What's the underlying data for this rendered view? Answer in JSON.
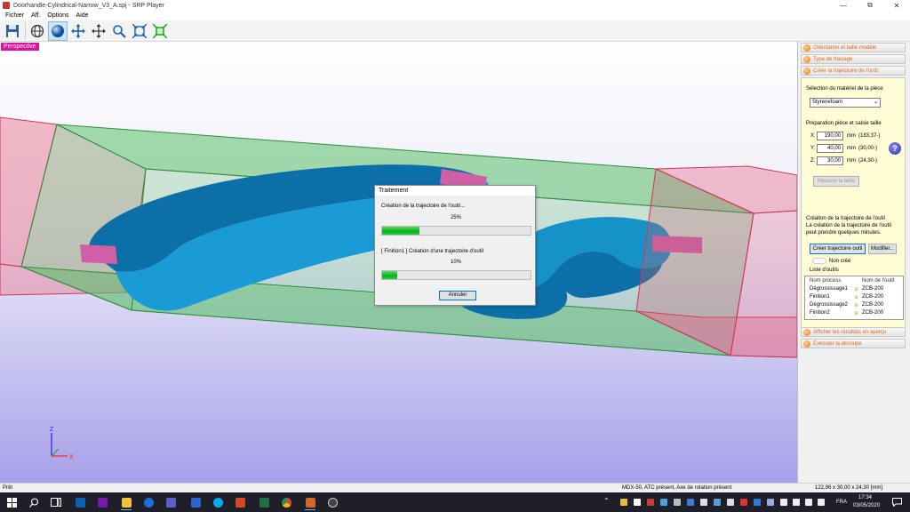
{
  "window": {
    "title": "Doorhandle-Cylindrical-Narrow_V3_A.spj - SRP Player",
    "minimize": "—",
    "restore": "⧉",
    "close": "✕"
  },
  "menu": {
    "items": [
      {
        "label": "Fichier"
      },
      {
        "label": "Aff."
      },
      {
        "label": "Options"
      },
      {
        "label": "Aide"
      }
    ]
  },
  "toolbar": {
    "tools": [
      {
        "icon": "save-icon"
      },
      {
        "icon": "globe-icon"
      },
      {
        "icon": "sphere-icon"
      },
      {
        "icon": "move-icon"
      },
      {
        "icon": "pan-icon"
      },
      {
        "icon": "zoom-icon"
      },
      {
        "icon": "fit-icon"
      },
      {
        "icon": "fit-all-icon"
      }
    ]
  },
  "viewport": {
    "label": "Perspective",
    "axes": {
      "z": "Z",
      "x": "X"
    }
  },
  "dialog": {
    "title": "Traitement",
    "task1_text": "Création de la trajectoire de l'outil...",
    "task1_percent_label": "25%",
    "task1_progress": 25,
    "task2_text": "[ Finition1 ] Création d'une trajectoire d'outil",
    "task2_percent_label": "10%",
    "task2_progress": 10,
    "cancel_label": "Annuler"
  },
  "panel": {
    "sections": [
      {
        "label": "Orientation et taille modèle"
      },
      {
        "label": "Type de fraisage"
      },
      {
        "label": "Créer la trajectoire de l'outil"
      }
    ],
    "material_heading": "Sélection du matériel de la pièce",
    "material_value": "Styrenefoam",
    "size_heading": "Préparation pièce et saisie taille",
    "dims": [
      {
        "axis": "X:",
        "value": "190,00",
        "unit": "mm",
        "range": "(183,37-)"
      },
      {
        "axis": "Y:",
        "value": "40,00",
        "unit": "mm",
        "range": "(30,00-)"
      },
      {
        "axis": "Z:",
        "value": "30,00",
        "unit": "mm",
        "range": "(24,30-)"
      }
    ],
    "help_label": "?",
    "measure_btn": "Mesurer la taille",
    "path_heading": "Création de la trajectoire de l'outil",
    "path_note_1": "La création de la trajectoire de l'outil",
    "path_note_2": "peut prendre quelques minutes.",
    "create_btn": "Créer trajectoire outil",
    "modify_btn": "Modifier...",
    "status_label": "Non créé",
    "tools_list_label": "Liste d'outils",
    "table": {
      "headers": [
        "Nom process",
        "Nom de l'outil"
      ],
      "rows": [
        {
          "process": "Dégrossissage1",
          "tool": "ZCB-200"
        },
        {
          "process": "Finition1",
          "tool": "ZCB-200"
        },
        {
          "process": "Dégrossissage2",
          "tool": "ZCB-200"
        },
        {
          "process": "Finition2",
          "tool": "ZCB-200"
        }
      ]
    },
    "preview_btn": "Afficher les résultats en aperçu",
    "cut_btn": "Exécuter la découpe"
  },
  "statusbar": {
    "left": "Prêt",
    "center": "MDX-50, ATC présent, Axe de rotation présent",
    "right": "122,96 x 30,00 x 24,30 [mm]"
  },
  "taskbar": {
    "lang": "FRA",
    "time": "17:34",
    "date": "03/05/2020"
  },
  "colors": {
    "accent": "#e06a1a",
    "model": "#1592c8",
    "stock_box": "#5bbf6a",
    "side_box": "#e86b86",
    "progress": "#06b025"
  }
}
